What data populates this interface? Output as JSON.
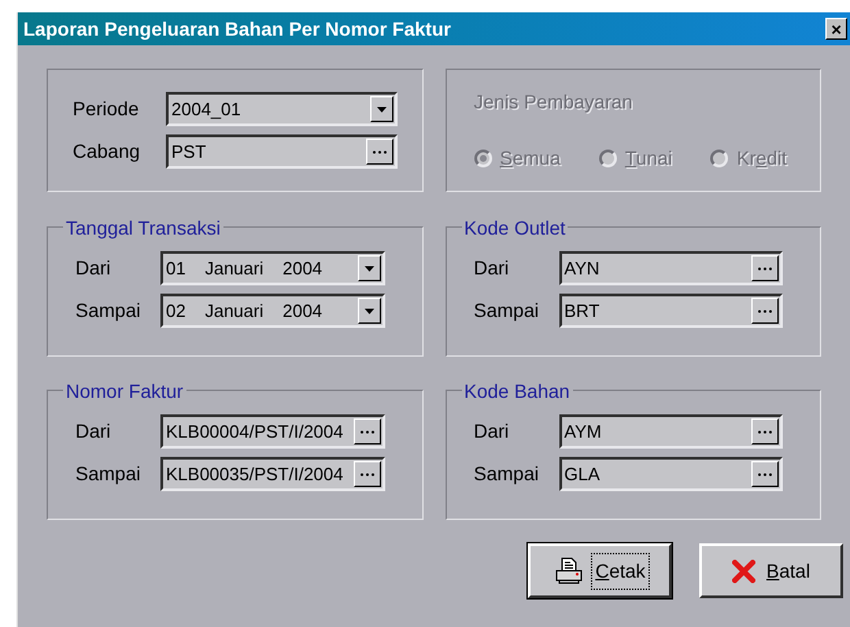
{
  "window": {
    "title": "Laporan Pengeluaran Bahan Per Nomor Faktur",
    "close": "×"
  },
  "general": {
    "fields": [
      {
        "label": "Periode",
        "value": "2004_01",
        "kind": "dropdown"
      },
      {
        "label": "Cabang",
        "value": "PST",
        "kind": "lookup"
      }
    ]
  },
  "payment": {
    "title": "Jenis Pembayaran",
    "disabled": true,
    "options": [
      {
        "accel": "S",
        "after": "emua",
        "selected": true
      },
      {
        "accel": "T",
        "after": "unai",
        "selected": false
      },
      {
        "before": "Kr",
        "accel": "e",
        "after": "dit",
        "selected": false
      }
    ]
  },
  "groups": [
    {
      "title": "Tanggal Transaksi",
      "fields": [
        {
          "label": "Dari",
          "kind": "date",
          "day": "01",
          "month": "Januari",
          "year": "2004"
        },
        {
          "label": "Sampai",
          "kind": "date",
          "day": "02",
          "month": "Januari",
          "year": "2004"
        }
      ]
    },
    {
      "title": "Kode Outlet",
      "fields": [
        {
          "label": "Dari",
          "kind": "lookup",
          "value": "AYN"
        },
        {
          "label": "Sampai",
          "kind": "lookup",
          "value": "BRT"
        }
      ]
    },
    {
      "title": "Nomor Faktur",
      "fields": [
        {
          "label": "Dari",
          "kind": "lookup",
          "value": "KLB00004/PST/I/2004"
        },
        {
          "label": "Sampai",
          "kind": "lookup",
          "value": "KLB00035/PST/I/2004"
        }
      ]
    },
    {
      "title": "Kode Bahan",
      "fields": [
        {
          "label": "Dari",
          "kind": "lookup",
          "value": "AYM"
        },
        {
          "label": "Sampai",
          "kind": "lookup",
          "value": "GLA"
        }
      ]
    }
  ],
  "buttons": [
    {
      "kind": "print",
      "accel": "C",
      "after": "etak",
      "focused": true
    },
    {
      "kind": "cancel",
      "accel": "B",
      "after": "atal",
      "focused": false
    }
  ]
}
